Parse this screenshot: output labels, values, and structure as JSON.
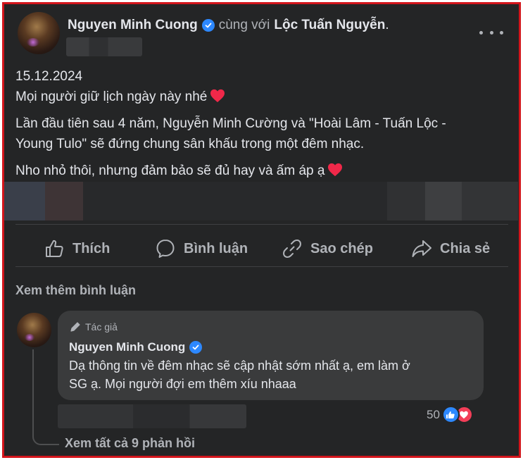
{
  "post": {
    "author": "Nguyen Minh Cuong",
    "with_text": "cùng với",
    "tagged": "Lộc Tuấn Nguyễn",
    "period": ".",
    "lines": {
      "date": "15.12.2024",
      "p1": "Mọi người giữ lịch ngày này nhé",
      "p2a": "Lần đầu tiên sau 4 năm, Nguyễn Minh Cường và \"Hoài Lâm - Tuấn Lộc -",
      "p2b": "Young Tulo\" sẽ đứng chung sân khấu trong một đêm nhạc.",
      "p3": "Nho nhỏ thôi, nhưng đảm bảo sẽ đủ hay và ấm áp ạ"
    }
  },
  "actions": {
    "like": "Thích",
    "comment": "Bình luận",
    "copy": "Sao chép",
    "share": "Chia sẻ"
  },
  "comments": {
    "see_more": "Xem thêm bình luận",
    "items": [
      {
        "badge": "Tác giả",
        "author": "Nguyen Minh Cuong",
        "line1": "Dạ thông tin về đêm nhạc sẽ cập nhật sớm nhất ạ, em làm ở",
        "line2": "SG ạ. Mọi người đợi em thêm xíu nhaaa",
        "reaction_count": "50",
        "reactions": [
          "like",
          "love"
        ]
      }
    ],
    "view_replies": "Xem tất cả 9 phản hồi"
  },
  "colors": {
    "background": "#242526",
    "frame_border": "#d3151b",
    "verified": "#2d88ff",
    "heart": "#f02849"
  },
  "icons": [
    "verified-badge-icon",
    "heart-icon",
    "like-icon",
    "comment-icon",
    "link-icon",
    "share-icon",
    "pencil-icon",
    "like-reaction-icon",
    "love-reaction-icon",
    "more-options-icon"
  ]
}
